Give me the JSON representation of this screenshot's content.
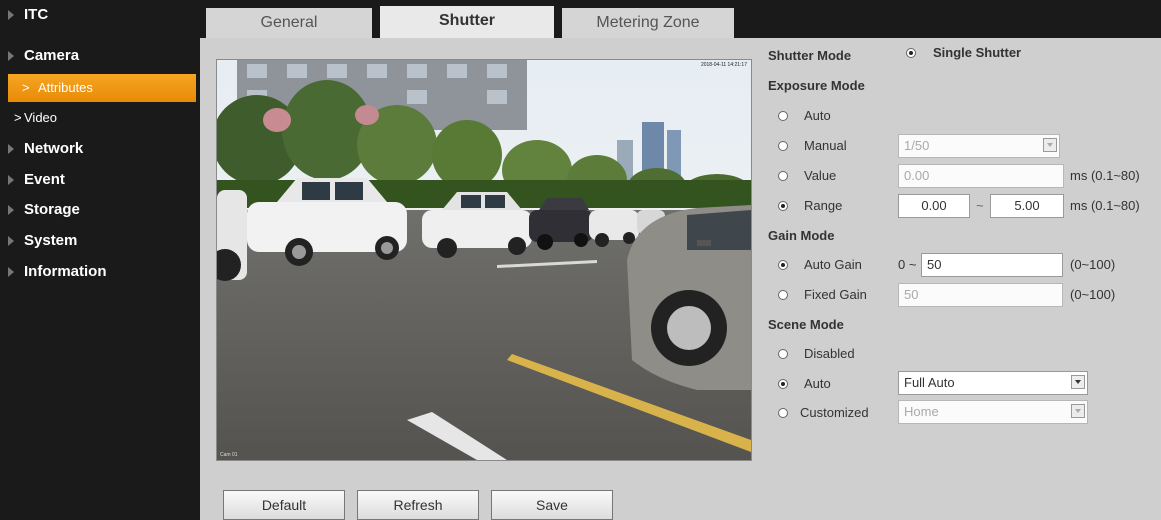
{
  "sidebar": {
    "items": [
      {
        "label": "ITC"
      },
      {
        "label": "Camera"
      },
      {
        "label": "Attributes"
      },
      {
        "label": "Video"
      },
      {
        "label": "Network"
      },
      {
        "label": "Event"
      },
      {
        "label": "Storage"
      },
      {
        "label": "System"
      },
      {
        "label": "Information"
      }
    ]
  },
  "tabs": [
    {
      "label": "General"
    },
    {
      "label": "Shutter"
    },
    {
      "label": "Metering Zone"
    }
  ],
  "video": {
    "timestamp": "2018-04-11 14:21:17",
    "channel": "Cam 01"
  },
  "buttons": {
    "default": "Default",
    "refresh": "Refresh",
    "save": "Save"
  },
  "shutter_mode": {
    "label": "Shutter Mode",
    "value": "Single Shutter"
  },
  "exposure_mode": {
    "label": "Exposure Mode",
    "auto": "Auto",
    "manual": "Manual",
    "manual_value": "1/50",
    "value": "Value",
    "value_input": "0.00",
    "value_unit": "ms (0.1~80)",
    "range": "Range",
    "range_min": "0.00",
    "range_sep": "~",
    "range_max": "5.00",
    "range_unit": "ms (0.1~80)"
  },
  "gain_mode": {
    "label": "Gain Mode",
    "auto_gain": "Auto Gain",
    "auto_prefix": "0 ~",
    "auto_value": "50",
    "auto_range": "(0~100)",
    "fixed_gain": "Fixed Gain",
    "fixed_value": "50",
    "fixed_range": "(0~100)"
  },
  "scene_mode": {
    "label": "Scene Mode",
    "disabled": "Disabled",
    "auto": "Auto",
    "auto_value": "Full Auto",
    "customized": "Customized",
    "customized_value": "Home"
  }
}
